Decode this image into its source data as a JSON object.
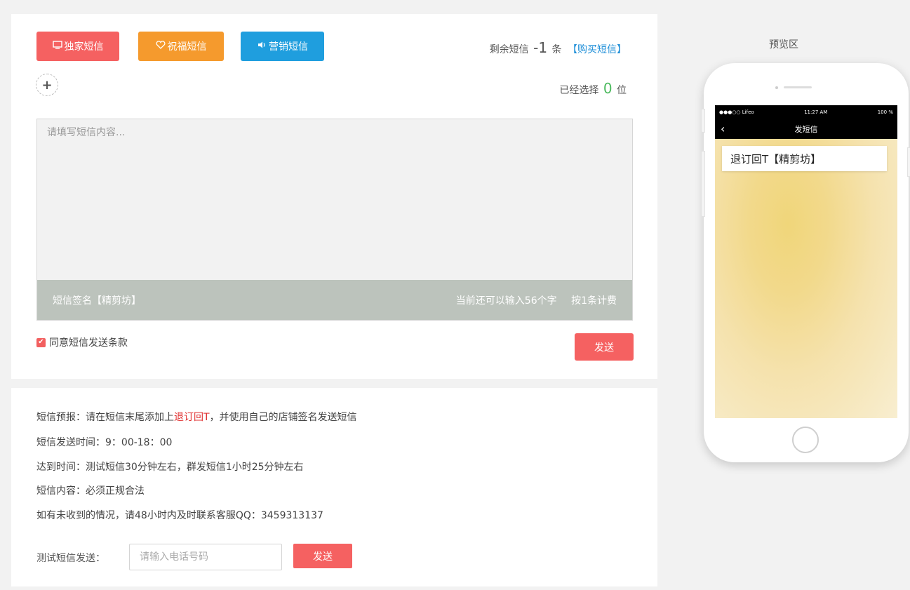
{
  "type_buttons": {
    "exclusive": "独家短信",
    "blessing": "祝福短信",
    "marketing": "营销短信"
  },
  "remaining": {
    "label": "剩余短信",
    "count": "-1",
    "unit": "条",
    "buy_link": "【购买短信】"
  },
  "add_icon": "+",
  "selected": {
    "label": "已经选择",
    "count": "0",
    "unit": "位"
  },
  "sms": {
    "placeholder": "请填写短信内容...",
    "signature": "短信签名【精剪坊】",
    "char_remaining": "当前还可以输入56个字",
    "billing": "按1条计费"
  },
  "agree_text": "同意短信发送条款",
  "send_label": "发送",
  "info": {
    "line1_prefix": "短信预报：请在短信末尾添加上",
    "line1_highlight": "退订回T",
    "line1_suffix": "，并使用自己的店铺签名发送短信",
    "line2": "短信发送时间：9：00-18：00",
    "line3": "达到时间：测试短信30分钟左右，群发短信1小时25分钟左右",
    "line4": "短信内容：必须正规合法",
    "line5": "如有未收到的情况，请48小时内及时联系客服QQ：3459313137"
  },
  "test": {
    "label": "测试短信发送：",
    "placeholder": "请输入电话号码",
    "send_label": "发送"
  },
  "preview": {
    "title": "预览区",
    "status_carrier": "●●●○○ Lifeo",
    "status_time": "11:27 AM",
    "status_battery": "100 %",
    "nav_title": "发短信",
    "message": "退订回T【精剪坊】"
  },
  "colors": {
    "red_button": "#f56161",
    "orange_button": "#f59a2d",
    "blue_button": "#1f9ede",
    "selected_green": "#4cba5e",
    "link_blue": "#1f8fd8",
    "highlight_red": "#e03030"
  }
}
